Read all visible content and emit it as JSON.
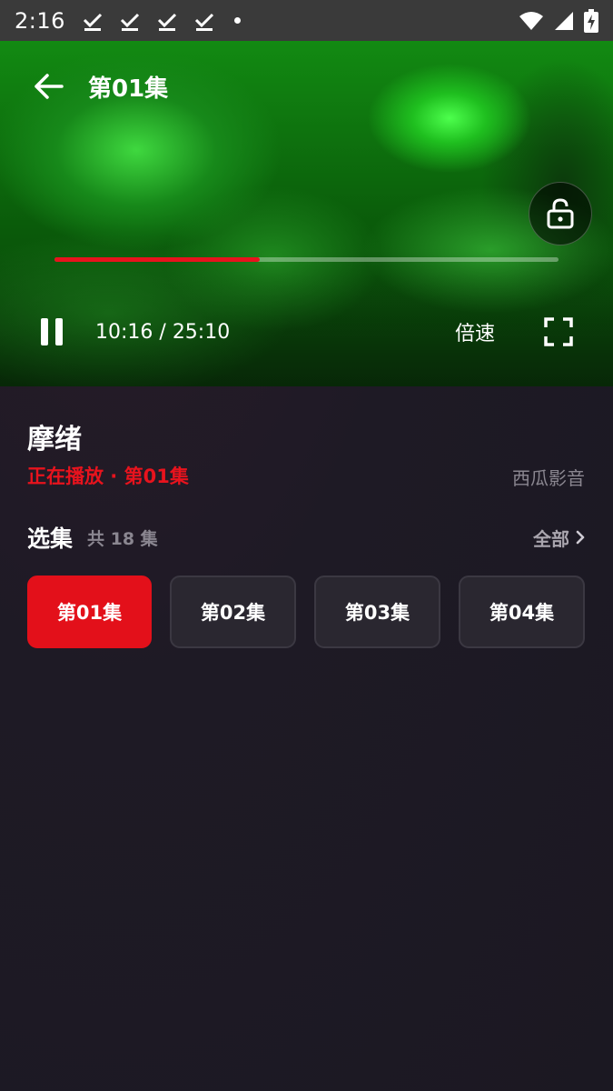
{
  "status_bar": {
    "time": "2:16"
  },
  "player": {
    "title": "第01集",
    "current_time": "10:16",
    "duration": "25:10",
    "time_separator": " / ",
    "progress_fraction": 0.408,
    "speed_label": "倍速",
    "accent_color": "#e8131d"
  },
  "show": {
    "title": "摩绪",
    "now_playing": "正在播放 · 第01集",
    "source": "西瓜影音"
  },
  "episodes": {
    "section_title": "选集",
    "count_label": "共 18 集",
    "all_label": "全部",
    "items": [
      {
        "label": "第01集",
        "active": true
      },
      {
        "label": "第02集",
        "active": false
      },
      {
        "label": "第03集",
        "active": false
      },
      {
        "label": "第04集",
        "active": false
      }
    ]
  }
}
